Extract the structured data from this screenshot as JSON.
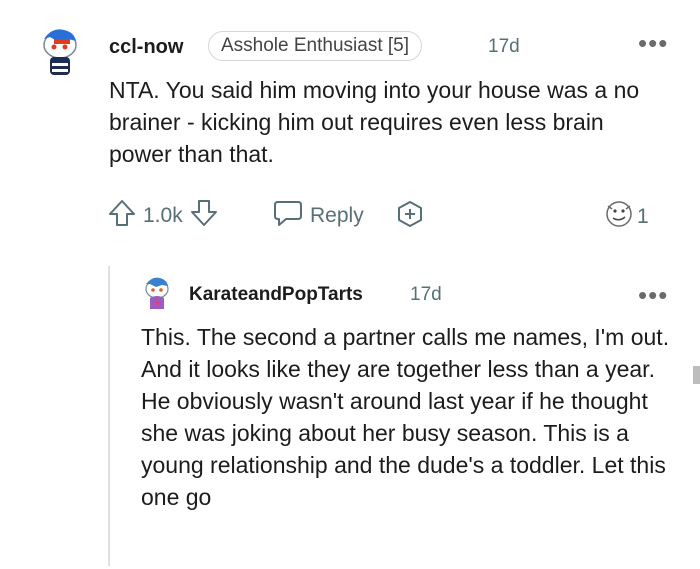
{
  "comment": {
    "username": "ccl-now",
    "flair": "Asshole Enthusiast [5]",
    "time": "17d",
    "more": "•••",
    "body": "NTA. You said him moving into your house was a no brainer - kicking him out requires even less brain power than that.",
    "votes": "1.0k",
    "reply_label": "Reply",
    "award_count": "1"
  },
  "reply": {
    "username": "KarateandPopTarts",
    "time": "17d",
    "more": "•••",
    "body": "This. The second a partner calls me names, I'm out. And it looks like they are together less than a year. He obviously wasn't around last year if he thought she was joking about her busy season. This is a young relationship and the dude's a toddler. Let this one go"
  },
  "colors": {
    "accent_blue": "#2a6fd6",
    "muted": "#576f76"
  },
  "icons": [
    "snoo-avatar-icon",
    "more-options-icon",
    "upvote-icon",
    "downvote-icon",
    "reply-icon",
    "award-add-icon",
    "award-emoji-icon"
  ]
}
